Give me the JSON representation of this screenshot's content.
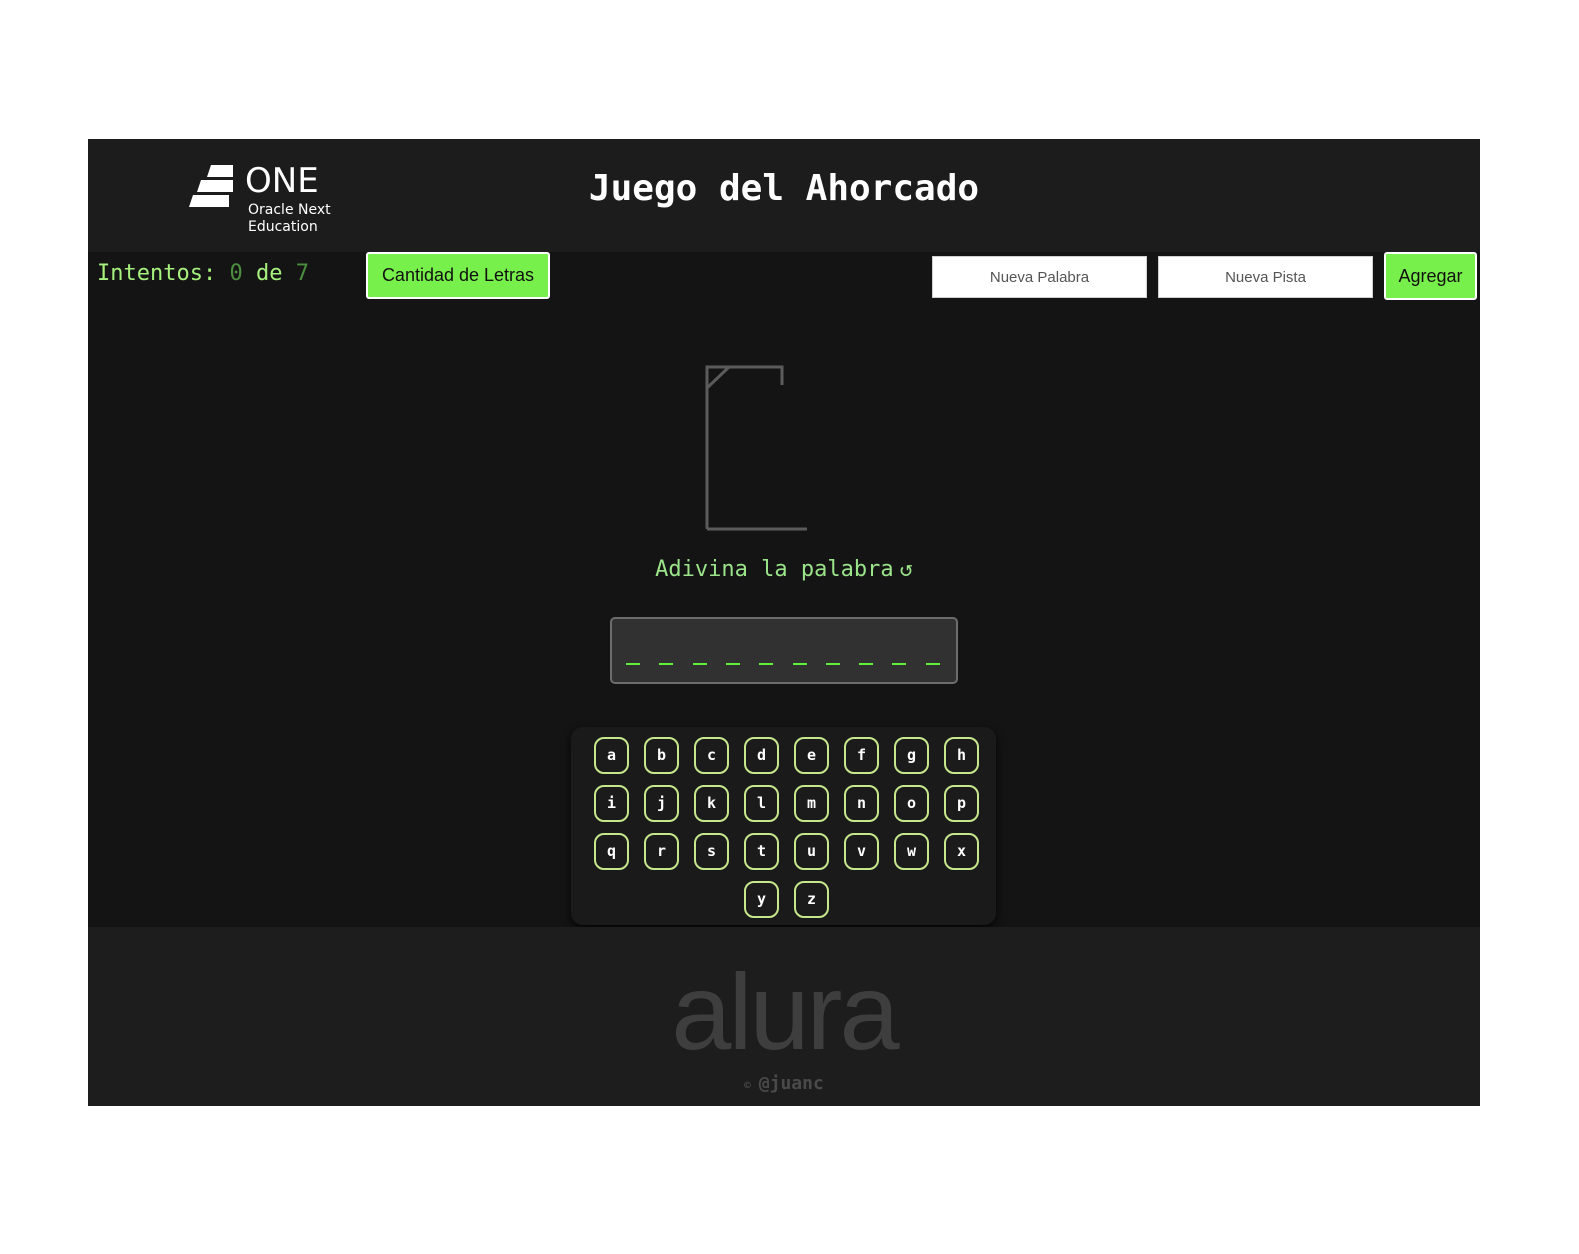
{
  "header": {
    "logo": {
      "name": "ONE",
      "line1": "Oracle Next",
      "line2": "Education"
    },
    "title": "Juego del Ahorcado"
  },
  "toolbar": {
    "attempts_label": "Intentos:",
    "attempts_current": "0",
    "attempts_of": "de",
    "attempts_max": "7",
    "letter_count_button": "Cantidad de Letras",
    "new_word_placeholder": "Nueva Palabra",
    "new_hint_placeholder": "Nueva Pista",
    "add_button": "Agregar"
  },
  "game": {
    "prompt": "Adivina la palabra",
    "reload_icon": "↺",
    "blank_count": 10
  },
  "keyboard": {
    "keys": [
      "a",
      "b",
      "c",
      "d",
      "e",
      "f",
      "g",
      "h",
      "i",
      "j",
      "k",
      "l",
      "m",
      "n",
      "o",
      "p",
      "q",
      "r",
      "s",
      "t",
      "u",
      "v",
      "w",
      "x",
      "y",
      "z"
    ]
  },
  "footer": {
    "brand": "alura",
    "copyright_symbol": "©",
    "author": "@juanc"
  },
  "colors": {
    "accent_green": "#78f04b",
    "text_green": "#a6f07e",
    "key_border": "#c7e78d",
    "background": "#141414"
  }
}
